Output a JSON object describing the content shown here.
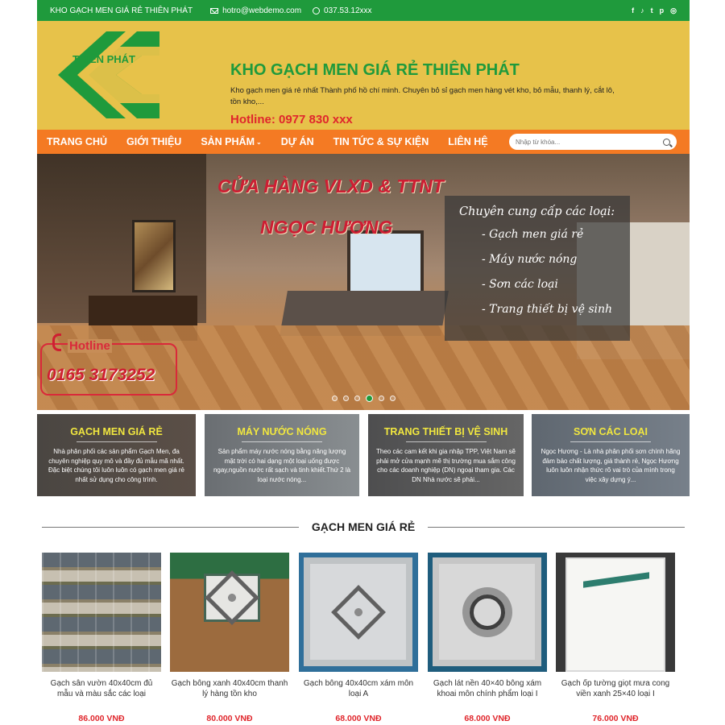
{
  "topbar": {
    "site_name": "KHO GẠCH MEN GIÁ RẺ THIÊN PHÁT",
    "email": "hotro@webdemo.com",
    "phone": "037.53.12xxx",
    "social_icons": [
      "facebook-icon",
      "tiktok-icon",
      "twitter-icon",
      "pinterest-icon",
      "globe-icon"
    ]
  },
  "header": {
    "logo_text": "THIÊN PHÁT",
    "title": "KHO GẠCH MEN GIÁ RẺ THIÊN PHÁT",
    "description": "Kho gạch men giá rẻ nhất Thành phố hồ chí minh. Chuyên bỏ sỉ gạch men hàng vét kho, bỏ mẫu, thanh lý, cắt lô, tồn kho,...",
    "hotline": "Hotline: 0977 830 xxx"
  },
  "nav": {
    "items": [
      {
        "label": "TRANG CHỦ"
      },
      {
        "label": "GIỚI THIỆU"
      },
      {
        "label": "SẢN PHẨM"
      },
      {
        "label": "DỰ ÁN"
      },
      {
        "label": "TIN TỨC & SỰ KIỆN"
      },
      {
        "label": "LIÊN HỆ"
      }
    ],
    "search_placeholder": "Nhập từ khóa..."
  },
  "banner": {
    "title": "CỬA HÀNG VLXD & TTNT",
    "subtitle": "NGỌC HƯƠNG",
    "panel_title": "Chuyên cung cấp các loại:",
    "panel_items": [
      "- Gạch men giá rẻ",
      "- Máy nước nóng",
      "- Sơn các loại",
      "- Trang thiết bị vệ sinh"
    ],
    "hotline_label": "Hotline",
    "hotline_number": "0165 3173252",
    "slides_count": 6,
    "active_slide": 4
  },
  "categories": [
    {
      "title": "GẠCH MEN GIÁ RẺ",
      "description": "Nhà phân phối các sản phẩm Gạch Men, đa chuyên nghiệp quy mô và đầy đủ mẫu mã nhất. Đặc biệt chúng tôi luôn luôn có gạch men giá rẻ nhất sử dụng cho công trình."
    },
    {
      "title": "MÁY NƯỚC NÓNG",
      "description": "Sản phẩm máy nước nóng bằng năng lượng mặt trời có hai dạng một loại uống được ngay,nguồn nước rất sạch và tinh khiết.Thứ 2 là loại nước nóng..."
    },
    {
      "title": "TRANG THIẾT BỊ VỆ SINH",
      "description": "Theo các cam kết khi gia nhập TPP, Việt Nam sẽ phải mở cửa mạnh mẽ thị trường mua sắm công cho các doanh nghiệp (DN) ngoại tham gia. Các DN Nhà nước sẽ phải..."
    },
    {
      "title": "SƠN CÁC LOẠI",
      "description": "Ngọc Hương - Là nhà phân phối sơn chính hãng đảm bảo chất lượng, giá thành rẻ, Ngọc Hương luôn luôn nhận thức rõ vai trò của mình trong việc xây dựng ý..."
    }
  ],
  "section": {
    "title": "GẠCH MEN GIÁ RẺ"
  },
  "products": [
    {
      "name": "Gạch sân vườn 40x40cm đủ mẫu và màu sắc các loại",
      "price": "86.000 VNĐ"
    },
    {
      "name": "Gạch bông xanh 40x40cm thanh lý hàng tồn kho",
      "price": "80.000 VNĐ"
    },
    {
      "name": "Gạch bông 40x40cm xám môn loại A",
      "price": "68.000 VNĐ"
    },
    {
      "name": "Gạch lát nền 40×40 bông xám khoai môn chính phẩm loại I",
      "price": "68.000 VNĐ"
    },
    {
      "name": "Gạch ốp tường giọt mưa cong viền xanh 25×40 loại I",
      "price": "76.000 VNĐ"
    }
  ],
  "colors": {
    "green": "#1f9a3c",
    "yellow": "#e7c24a",
    "orange": "#f47a23",
    "red": "#e0262c"
  }
}
